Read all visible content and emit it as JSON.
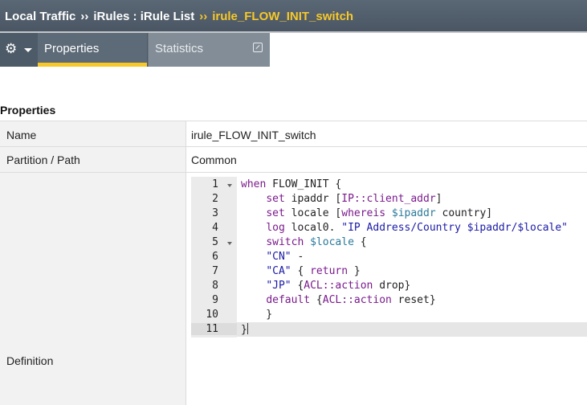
{
  "breadcrumb": {
    "items": [
      "Local Traffic",
      "iRules : iRule List",
      "irule_FLOW_INIT_switch"
    ],
    "separator": "››"
  },
  "tabs": {
    "gear_icon": "gear-icon",
    "active": "Properties",
    "inactive": "Statistics",
    "popout_icon": "popout-icon"
  },
  "section": {
    "title": "Properties"
  },
  "properties": {
    "name_label": "Name",
    "name_value": "irule_FLOW_INIT_switch",
    "partition_label": "Partition / Path",
    "partition_value": "Common",
    "definition_label": "Definition"
  },
  "editor": {
    "line_numbers": [
      "1",
      "2",
      "3",
      "4",
      "5",
      "6",
      "7",
      "8",
      "9",
      "10",
      "11"
    ],
    "lines": [
      "when FLOW_INIT {",
      "    set ipaddr [IP::client_addr]",
      "    set locale [whereis $ipaddr country]",
      "    log local0. \"IP Address/Country $ipaddr/$locale\"",
      "    switch $locale {",
      "    \"CN\" -",
      "    \"CA\" { return }",
      "    \"JP\" {ACL::action drop}",
      "    default {ACL::action reset}",
      "    }",
      "}"
    ]
  },
  "colors": {
    "header_bg": "#4a5663",
    "accent_yellow": "#f7c82a",
    "keyword": "#7a1a8c",
    "variable": "#2b7a9b",
    "string": "#1a1aa6"
  }
}
